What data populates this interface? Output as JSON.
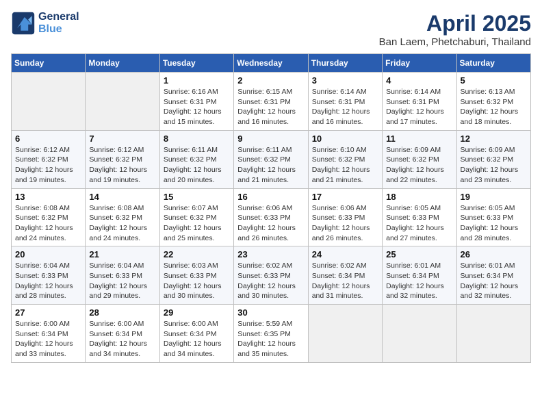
{
  "header": {
    "logo_line1": "General",
    "logo_line2": "Blue",
    "month": "April 2025",
    "location": "Ban Laem, Phetchaburi, Thailand"
  },
  "weekdays": [
    "Sunday",
    "Monday",
    "Tuesday",
    "Wednesday",
    "Thursday",
    "Friday",
    "Saturday"
  ],
  "weeks": [
    [
      {
        "day": "",
        "info": ""
      },
      {
        "day": "",
        "info": ""
      },
      {
        "day": "1",
        "info": "Sunrise: 6:16 AM\nSunset: 6:31 PM\nDaylight: 12 hours\nand 15 minutes."
      },
      {
        "day": "2",
        "info": "Sunrise: 6:15 AM\nSunset: 6:31 PM\nDaylight: 12 hours\nand 16 minutes."
      },
      {
        "day": "3",
        "info": "Sunrise: 6:14 AM\nSunset: 6:31 PM\nDaylight: 12 hours\nand 16 minutes."
      },
      {
        "day": "4",
        "info": "Sunrise: 6:14 AM\nSunset: 6:31 PM\nDaylight: 12 hours\nand 17 minutes."
      },
      {
        "day": "5",
        "info": "Sunrise: 6:13 AM\nSunset: 6:32 PM\nDaylight: 12 hours\nand 18 minutes."
      }
    ],
    [
      {
        "day": "6",
        "info": "Sunrise: 6:12 AM\nSunset: 6:32 PM\nDaylight: 12 hours\nand 19 minutes."
      },
      {
        "day": "7",
        "info": "Sunrise: 6:12 AM\nSunset: 6:32 PM\nDaylight: 12 hours\nand 19 minutes."
      },
      {
        "day": "8",
        "info": "Sunrise: 6:11 AM\nSunset: 6:32 PM\nDaylight: 12 hours\nand 20 minutes."
      },
      {
        "day": "9",
        "info": "Sunrise: 6:11 AM\nSunset: 6:32 PM\nDaylight: 12 hours\nand 21 minutes."
      },
      {
        "day": "10",
        "info": "Sunrise: 6:10 AM\nSunset: 6:32 PM\nDaylight: 12 hours\nand 21 minutes."
      },
      {
        "day": "11",
        "info": "Sunrise: 6:09 AM\nSunset: 6:32 PM\nDaylight: 12 hours\nand 22 minutes."
      },
      {
        "day": "12",
        "info": "Sunrise: 6:09 AM\nSunset: 6:32 PM\nDaylight: 12 hours\nand 23 minutes."
      }
    ],
    [
      {
        "day": "13",
        "info": "Sunrise: 6:08 AM\nSunset: 6:32 PM\nDaylight: 12 hours\nand 24 minutes."
      },
      {
        "day": "14",
        "info": "Sunrise: 6:08 AM\nSunset: 6:32 PM\nDaylight: 12 hours\nand 24 minutes."
      },
      {
        "day": "15",
        "info": "Sunrise: 6:07 AM\nSunset: 6:32 PM\nDaylight: 12 hours\nand 25 minutes."
      },
      {
        "day": "16",
        "info": "Sunrise: 6:06 AM\nSunset: 6:33 PM\nDaylight: 12 hours\nand 26 minutes."
      },
      {
        "day": "17",
        "info": "Sunrise: 6:06 AM\nSunset: 6:33 PM\nDaylight: 12 hours\nand 26 minutes."
      },
      {
        "day": "18",
        "info": "Sunrise: 6:05 AM\nSunset: 6:33 PM\nDaylight: 12 hours\nand 27 minutes."
      },
      {
        "day": "19",
        "info": "Sunrise: 6:05 AM\nSunset: 6:33 PM\nDaylight: 12 hours\nand 28 minutes."
      }
    ],
    [
      {
        "day": "20",
        "info": "Sunrise: 6:04 AM\nSunset: 6:33 PM\nDaylight: 12 hours\nand 28 minutes."
      },
      {
        "day": "21",
        "info": "Sunrise: 6:04 AM\nSunset: 6:33 PM\nDaylight: 12 hours\nand 29 minutes."
      },
      {
        "day": "22",
        "info": "Sunrise: 6:03 AM\nSunset: 6:33 PM\nDaylight: 12 hours\nand 30 minutes."
      },
      {
        "day": "23",
        "info": "Sunrise: 6:02 AM\nSunset: 6:33 PM\nDaylight: 12 hours\nand 30 minutes."
      },
      {
        "day": "24",
        "info": "Sunrise: 6:02 AM\nSunset: 6:34 PM\nDaylight: 12 hours\nand 31 minutes."
      },
      {
        "day": "25",
        "info": "Sunrise: 6:01 AM\nSunset: 6:34 PM\nDaylight: 12 hours\nand 32 minutes."
      },
      {
        "day": "26",
        "info": "Sunrise: 6:01 AM\nSunset: 6:34 PM\nDaylight: 12 hours\nand 32 minutes."
      }
    ],
    [
      {
        "day": "27",
        "info": "Sunrise: 6:00 AM\nSunset: 6:34 PM\nDaylight: 12 hours\nand 33 minutes."
      },
      {
        "day": "28",
        "info": "Sunrise: 6:00 AM\nSunset: 6:34 PM\nDaylight: 12 hours\nand 34 minutes."
      },
      {
        "day": "29",
        "info": "Sunrise: 6:00 AM\nSunset: 6:34 PM\nDaylight: 12 hours\nand 34 minutes."
      },
      {
        "day": "30",
        "info": "Sunrise: 5:59 AM\nSunset: 6:35 PM\nDaylight: 12 hours\nand 35 minutes."
      },
      {
        "day": "",
        "info": ""
      },
      {
        "day": "",
        "info": ""
      },
      {
        "day": "",
        "info": ""
      }
    ]
  ]
}
